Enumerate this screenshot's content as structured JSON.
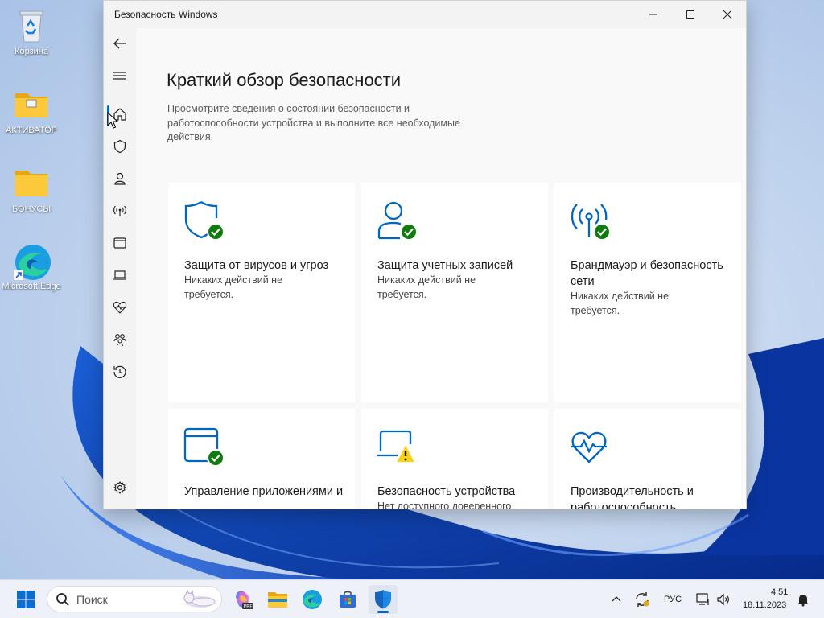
{
  "desktop": {
    "icons": [
      {
        "label": "Корзина"
      },
      {
        "label": "АКТИВАТОР"
      },
      {
        "label": "БОНУСЫ"
      },
      {
        "label": "Microsoft Edge"
      }
    ]
  },
  "window": {
    "title": "Безопасность Windows",
    "nav": [
      {
        "icon": "back-icon"
      },
      {
        "icon": "menu-icon"
      },
      {
        "icon": "home-icon",
        "selected": true
      },
      {
        "icon": "shield-icon"
      },
      {
        "icon": "person-icon"
      },
      {
        "icon": "network-icon"
      },
      {
        "icon": "app-browser-icon"
      },
      {
        "icon": "device-icon"
      },
      {
        "icon": "health-icon"
      },
      {
        "icon": "family-icon"
      },
      {
        "icon": "history-icon"
      },
      {
        "icon": "settings-icon"
      }
    ],
    "page_title": "Краткий обзор безопасности",
    "page_description": "Просмотрите сведения о состоянии безопасности и работоспособности устройства и выполните все необходимые действия.",
    "cards": [
      {
        "title": "Защита от вирусов и угроз",
        "status": "Никаких действий не требуется.",
        "state": "ok"
      },
      {
        "title": "Защита учетных записей",
        "status": "Никаких действий не требуется.",
        "state": "ok"
      },
      {
        "title": "Брандмауэр и безопасность сети",
        "status": "Никаких действий не требуется.",
        "state": "ok"
      },
      {
        "title": "Управление приложениями и",
        "status": "",
        "state": "ok"
      },
      {
        "title": "Безопасность устройства",
        "status": "Нет доступного доверенного",
        "state": "warning"
      },
      {
        "title": "Производительность и работоспособность",
        "status": "",
        "state": "none"
      }
    ]
  },
  "taskbar": {
    "search_placeholder": "Поиск",
    "language": "РУС",
    "time": "4:51",
    "date": "18.11.2023"
  },
  "colors": {
    "accent": "#0067c0",
    "ok_green": "#107c10",
    "warning_yellow": "#fcd116"
  }
}
